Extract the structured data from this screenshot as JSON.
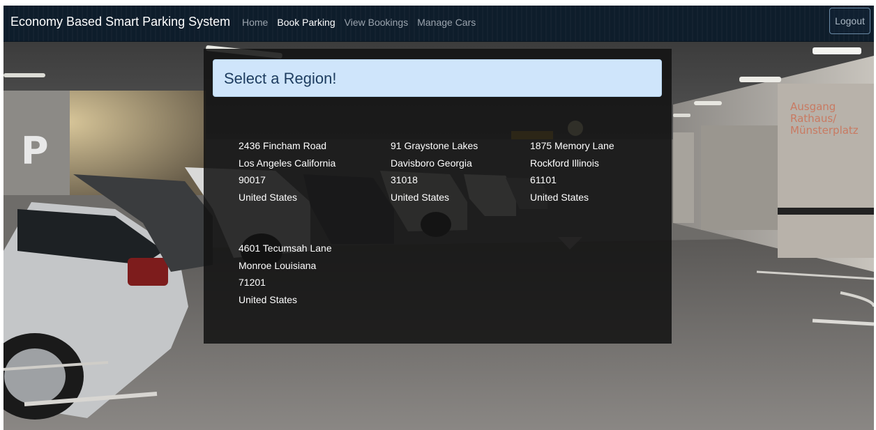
{
  "navbar": {
    "brand": "Economy Based Smart Parking System",
    "links": [
      {
        "label": "Home",
        "active": false
      },
      {
        "label": "Book Parking",
        "active": true
      },
      {
        "label": "View Bookings",
        "active": false
      },
      {
        "label": "Manage Cars",
        "active": false
      }
    ],
    "logout_label": "Logout"
  },
  "panel": {
    "title": "Select a Region!",
    "regions": [
      {
        "street": "2436 Fincham Road",
        "city_state": "Los Angeles California",
        "zip": "90017",
        "country": "United States"
      },
      {
        "street": "91 Graystone Lakes",
        "city_state": "Davisboro Georgia",
        "zip": "31018",
        "country": "United States"
      },
      {
        "street": "1875 Memory Lane",
        "city_state": "Rockford Illinois",
        "zip": "61101",
        "country": "United States"
      },
      {
        "street": "4601 Tecumsah Lane",
        "city_state": "Monroe Louisiana",
        "zip": "71201",
        "country": "United States"
      }
    ]
  },
  "background": {
    "signs": {
      "parking_letter": "P",
      "exit_sign": [
        "Ausgang",
        "Rathaus/",
        "Münsterplatz"
      ]
    }
  },
  "colors": {
    "navbar_bg": "#0e1d2b",
    "header_bg": "#cfe5fb",
    "header_text": "#1e3d60",
    "panel_bg": "rgba(18,18,18,0.86)"
  }
}
